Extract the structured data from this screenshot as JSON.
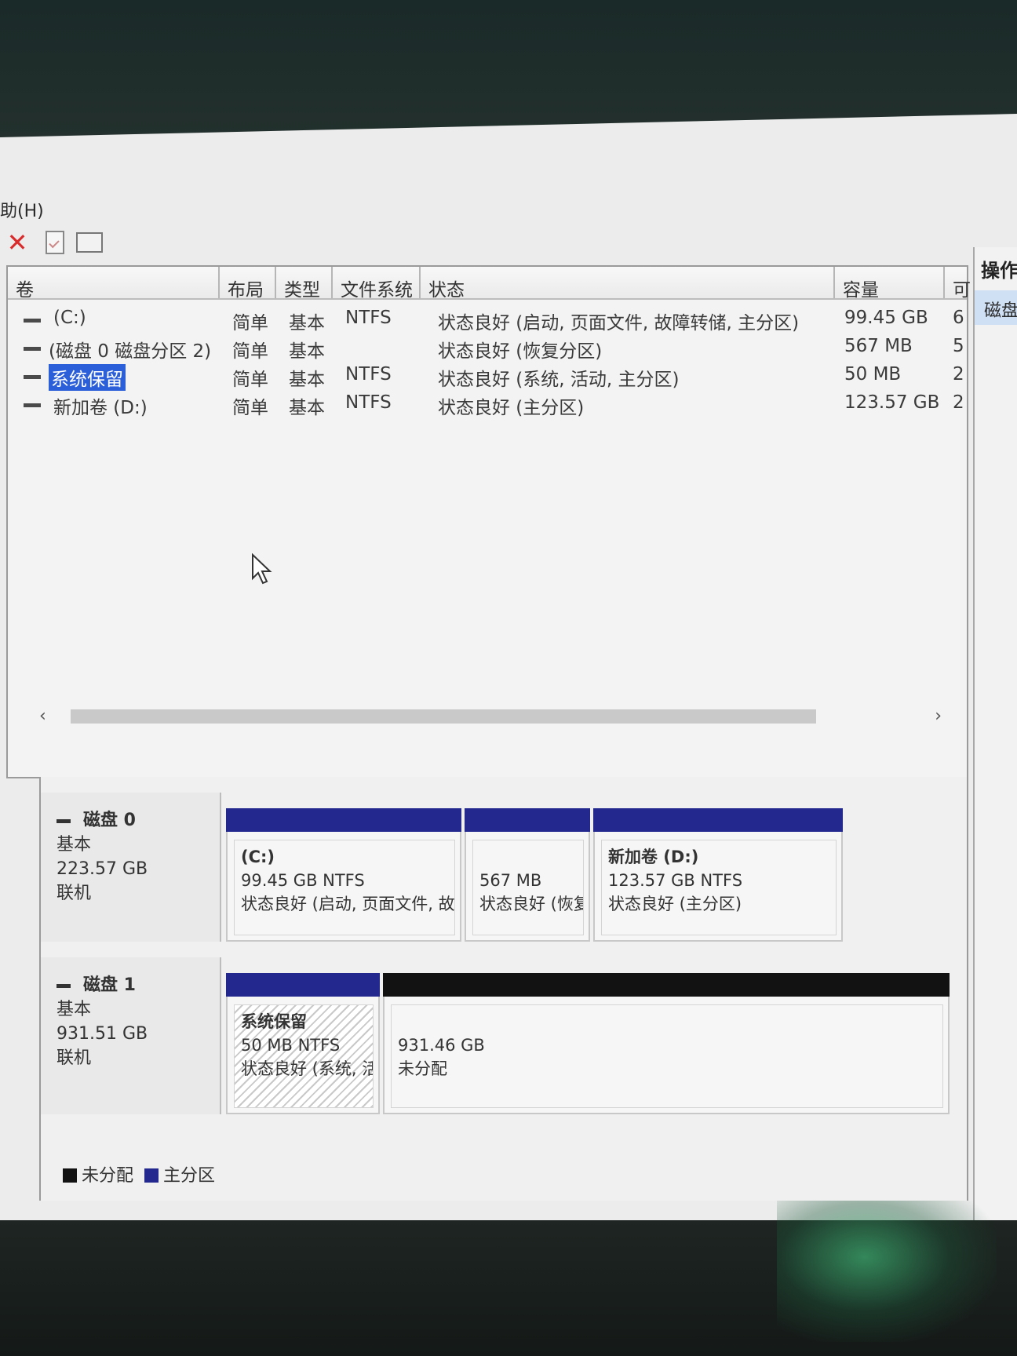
{
  "menu": {
    "help": "助(H)"
  },
  "toolbar": {
    "delete_icon": "close-icon",
    "properties_icon": "checked-document-icon",
    "panel_icon": "panel-icon"
  },
  "volume_table": {
    "headers": [
      "卷",
      "布局",
      "类型",
      "文件系统",
      "状态",
      "容量",
      "可"
    ],
    "rows": [
      {
        "volume": "(C:)",
        "layout": "简单",
        "type": "基本",
        "fs": "NTFS",
        "status": "状态良好 (启动, 页面文件, 故障转储, 主分区)",
        "capacity": "99.45 GB",
        "free": "6"
      },
      {
        "volume": "(磁盘 0 磁盘分区 2)",
        "layout": "简单",
        "type": "基本",
        "fs": "",
        "status": "状态良好 (恢复分区)",
        "capacity": "567 MB",
        "free": "5"
      },
      {
        "volume": "系统保留",
        "layout": "简单",
        "type": "基本",
        "fs": "NTFS",
        "status": "状态良好 (系统, 活动, 主分区)",
        "capacity": "50 MB",
        "free": "2"
      },
      {
        "volume": "新加卷 (D:)",
        "layout": "简单",
        "type": "基本",
        "fs": "NTFS",
        "status": "状态良好 (主分区)",
        "capacity": "123.57 GB",
        "free": "2"
      }
    ]
  },
  "actions": {
    "title": "操作",
    "item": "磁盘"
  },
  "disks": [
    {
      "name": "磁盘 0",
      "kind": "基本",
      "size": "223.57 GB",
      "state": "联机",
      "partitions": [
        {
          "title": "(C:)",
          "size": "99.45 GB NTFS",
          "status": "状态良好 (启动, 页面文件, 故"
        },
        {
          "title": "",
          "size": "567 MB",
          "status": "状态良好 (恢复"
        },
        {
          "title": "新加卷  (D:)",
          "size": "123.57 GB NTFS",
          "status": "状态良好 (主分区)"
        }
      ]
    },
    {
      "name": "磁盘 1",
      "kind": "基本",
      "size": "931.51 GB",
      "state": "联机",
      "partitions": [
        {
          "title": "系统保留",
          "size": "50 MB NTFS",
          "status": "状态良好 (系统, 活"
        },
        {
          "title": "",
          "size": "931.46 GB",
          "status": "未分配"
        }
      ]
    }
  ],
  "legend": [
    {
      "label": "未分配",
      "color": "#121212"
    },
    {
      "label": "主分区",
      "color": "#23288f"
    }
  ]
}
